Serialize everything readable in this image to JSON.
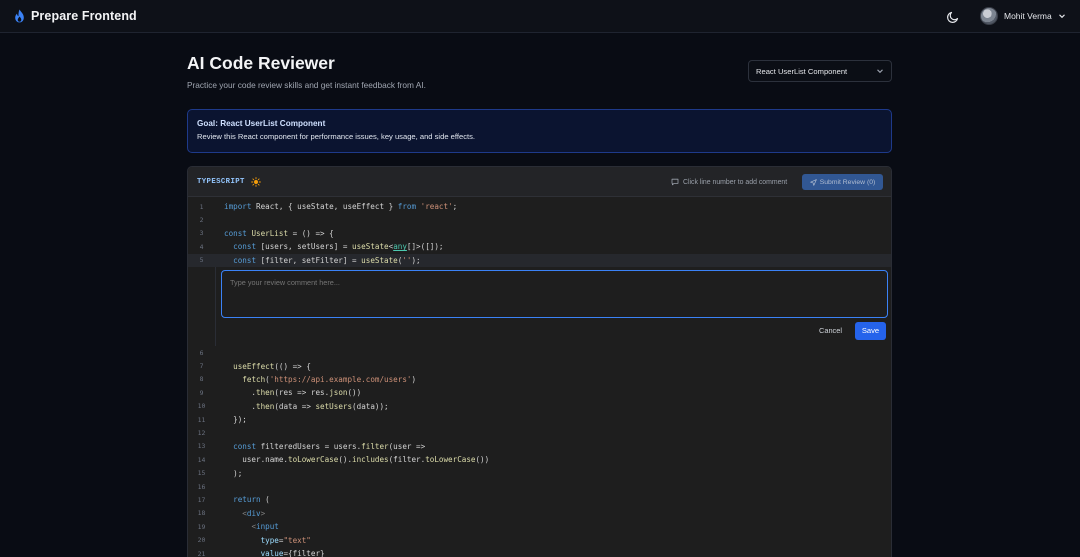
{
  "navbar": {
    "brand": "Prepare Frontend",
    "user_name": "Mohit Verma"
  },
  "header": {
    "title": "AI Code Reviewer",
    "subtitle": "Practice your code review skills and get instant feedback from AI.",
    "selected_challenge": "React UserList Component"
  },
  "goal": {
    "title": "Goal: React UserList Component",
    "description": "Review this React component for performance issues, key usage, and side effects."
  },
  "editor": {
    "language": "TYPESCRIPT",
    "hint": "Click line number to add comment",
    "submit_label": "Submit Review (0)",
    "comment_placeholder": "Type your review comment here...",
    "cancel_label": "Cancel",
    "save_label": "Save",
    "lines_before": [
      "1",
      "2",
      "3",
      "4",
      "5"
    ],
    "lines_after": [
      "6",
      "7",
      "8",
      "9",
      "10",
      "11",
      "12",
      "13",
      "14",
      "15",
      "16",
      "17",
      "18",
      "19",
      "20",
      "21"
    ]
  },
  "colors": {
    "accent": "#2563eb",
    "goal_border": "#1e3a8a",
    "background": "#090c14"
  },
  "icons": {
    "logo": "flame-logo-icon",
    "theme": "moon-icon",
    "editor_theme": "sun-icon",
    "hint": "message-icon",
    "submit": "send-icon"
  }
}
